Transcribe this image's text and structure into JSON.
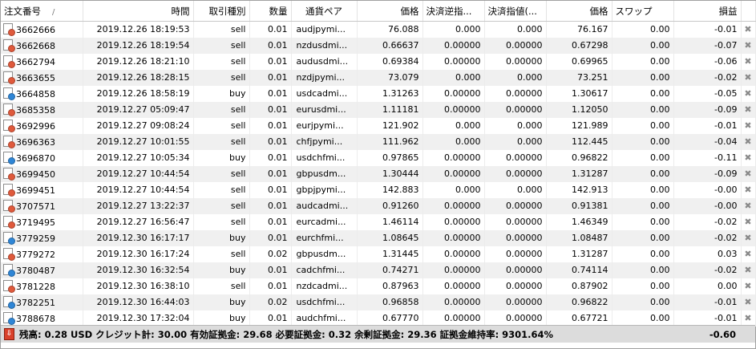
{
  "colors": {
    "sell": "#e05a3c",
    "buy": "#2f86d6"
  },
  "headers": {
    "ticket": "注文番号",
    "time": "時間",
    "type": "取引種別",
    "volume": "数量",
    "symbol": "通貨ペア",
    "price": "価格",
    "sl": "決済逆指...",
    "tp": "決済指値(...",
    "current_price": "価格",
    "swap": "スワップ",
    "profit": "損益"
  },
  "sort_indicator": "/",
  "close_glyph": "✖",
  "rows": [
    {
      "ticket": "3662666",
      "time": "2019.12.26 18:19:53",
      "type": "sell",
      "volume": "0.01",
      "symbol": "audjpymi...",
      "price": "76.088",
      "sl": "0.000",
      "tp": "0.000",
      "current": "76.167",
      "swap": "0.00",
      "profit": "-0.01"
    },
    {
      "ticket": "3662668",
      "time": "2019.12.26 18:19:54",
      "type": "sell",
      "volume": "0.01",
      "symbol": "nzdusdmi...",
      "price": "0.66637",
      "sl": "0.00000",
      "tp": "0.00000",
      "current": "0.67298",
      "swap": "0.00",
      "profit": "-0.07"
    },
    {
      "ticket": "3662794",
      "time": "2019.12.26 18:21:10",
      "type": "sell",
      "volume": "0.01",
      "symbol": "audusdmi...",
      "price": "0.69384",
      "sl": "0.00000",
      "tp": "0.00000",
      "current": "0.69965",
      "swap": "0.00",
      "profit": "-0.06"
    },
    {
      "ticket": "3663655",
      "time": "2019.12.26 18:28:15",
      "type": "sell",
      "volume": "0.01",
      "symbol": "nzdjpymi...",
      "price": "73.079",
      "sl": "0.000",
      "tp": "0.000",
      "current": "73.251",
      "swap": "0.00",
      "profit": "-0.02"
    },
    {
      "ticket": "3664858",
      "time": "2019.12.26 18:58:19",
      "type": "buy",
      "volume": "0.01",
      "symbol": "usdcadmi...",
      "price": "1.31263",
      "sl": "0.00000",
      "tp": "0.00000",
      "current": "1.30617",
      "swap": "0.00",
      "profit": "-0.05"
    },
    {
      "ticket": "3685358",
      "time": "2019.12.27 05:09:47",
      "type": "sell",
      "volume": "0.01",
      "symbol": "eurusdmi...",
      "price": "1.11181",
      "sl": "0.00000",
      "tp": "0.00000",
      "current": "1.12050",
      "swap": "0.00",
      "profit": "-0.09"
    },
    {
      "ticket": "3692996",
      "time": "2019.12.27 09:08:24",
      "type": "sell",
      "volume": "0.01",
      "symbol": "eurjpymi...",
      "price": "121.902",
      "sl": "0.000",
      "tp": "0.000",
      "current": "121.989",
      "swap": "0.00",
      "profit": "-0.01"
    },
    {
      "ticket": "3696363",
      "time": "2019.12.27 10:01:55",
      "type": "sell",
      "volume": "0.01",
      "symbol": "chfjpymi...",
      "price": "111.962",
      "sl": "0.000",
      "tp": "0.000",
      "current": "112.445",
      "swap": "0.00",
      "profit": "-0.04"
    },
    {
      "ticket": "3696870",
      "time": "2019.12.27 10:05:34",
      "type": "buy",
      "volume": "0.01",
      "symbol": "usdchfmi...",
      "price": "0.97865",
      "sl": "0.00000",
      "tp": "0.00000",
      "current": "0.96822",
      "swap": "0.00",
      "profit": "-0.11"
    },
    {
      "ticket": "3699450",
      "time": "2019.12.27 10:44:54",
      "type": "sell",
      "volume": "0.01",
      "symbol": "gbpusdm...",
      "price": "1.30444",
      "sl": "0.00000",
      "tp": "0.00000",
      "current": "1.31287",
      "swap": "0.00",
      "profit": "-0.09"
    },
    {
      "ticket": "3699451",
      "time": "2019.12.27 10:44:54",
      "type": "sell",
      "volume": "0.01",
      "symbol": "gbpjpymi...",
      "price": "142.883",
      "sl": "0.000",
      "tp": "0.000",
      "current": "142.913",
      "swap": "0.00",
      "profit": "-0.00"
    },
    {
      "ticket": "3707571",
      "time": "2019.12.27 13:22:37",
      "type": "sell",
      "volume": "0.01",
      "symbol": "audcadmi...",
      "price": "0.91260",
      "sl": "0.00000",
      "tp": "0.00000",
      "current": "0.91381",
      "swap": "0.00",
      "profit": "-0.00"
    },
    {
      "ticket": "3719495",
      "time": "2019.12.27 16:56:47",
      "type": "sell",
      "volume": "0.01",
      "symbol": "eurcadmi...",
      "price": "1.46114",
      "sl": "0.00000",
      "tp": "0.00000",
      "current": "1.46349",
      "swap": "0.00",
      "profit": "-0.02"
    },
    {
      "ticket": "3779259",
      "time": "2019.12.30 16:17:17",
      "type": "buy",
      "volume": "0.01",
      "symbol": "eurchfmi...",
      "price": "1.08645",
      "sl": "0.00000",
      "tp": "0.00000",
      "current": "1.08487",
      "swap": "0.00",
      "profit": "-0.02"
    },
    {
      "ticket": "3779272",
      "time": "2019.12.30 16:17:24",
      "type": "sell",
      "volume": "0.02",
      "symbol": "gbpusdm...",
      "price": "1.31445",
      "sl": "0.00000",
      "tp": "0.00000",
      "current": "1.31287",
      "swap": "0.00",
      "profit": "0.03"
    },
    {
      "ticket": "3780487",
      "time": "2019.12.30 16:32:54",
      "type": "buy",
      "volume": "0.01",
      "symbol": "cadchfmi...",
      "price": "0.74271",
      "sl": "0.00000",
      "tp": "0.00000",
      "current": "0.74114",
      "swap": "0.00",
      "profit": "-0.02"
    },
    {
      "ticket": "3781228",
      "time": "2019.12.30 16:38:10",
      "type": "sell",
      "volume": "0.01",
      "symbol": "nzdcadmi...",
      "price": "0.87963",
      "sl": "0.00000",
      "tp": "0.00000",
      "current": "0.87902",
      "swap": "0.00",
      "profit": "0.00"
    },
    {
      "ticket": "3782251",
      "time": "2019.12.30 16:44:03",
      "type": "buy",
      "volume": "0.02",
      "symbol": "usdchfmi...",
      "price": "0.96858",
      "sl": "0.00000",
      "tp": "0.00000",
      "current": "0.96822",
      "swap": "0.00",
      "profit": "-0.01"
    },
    {
      "ticket": "3788678",
      "time": "2019.12.30 17:32:04",
      "type": "buy",
      "volume": "0.01",
      "symbol": "audchfmi...",
      "price": "0.67770",
      "sl": "0.00000",
      "tp": "0.00000",
      "current": "0.67721",
      "swap": "0.00",
      "profit": "-0.01"
    }
  ],
  "footer": {
    "summary": "残高: 0.28 USD  クレジット計: 30.00  有効証拠金: 29.68  必要証拠金: 0.32  余剰証拠金: 29.36  証拠金維持率: 9301.64%",
    "total": "-0.60"
  }
}
